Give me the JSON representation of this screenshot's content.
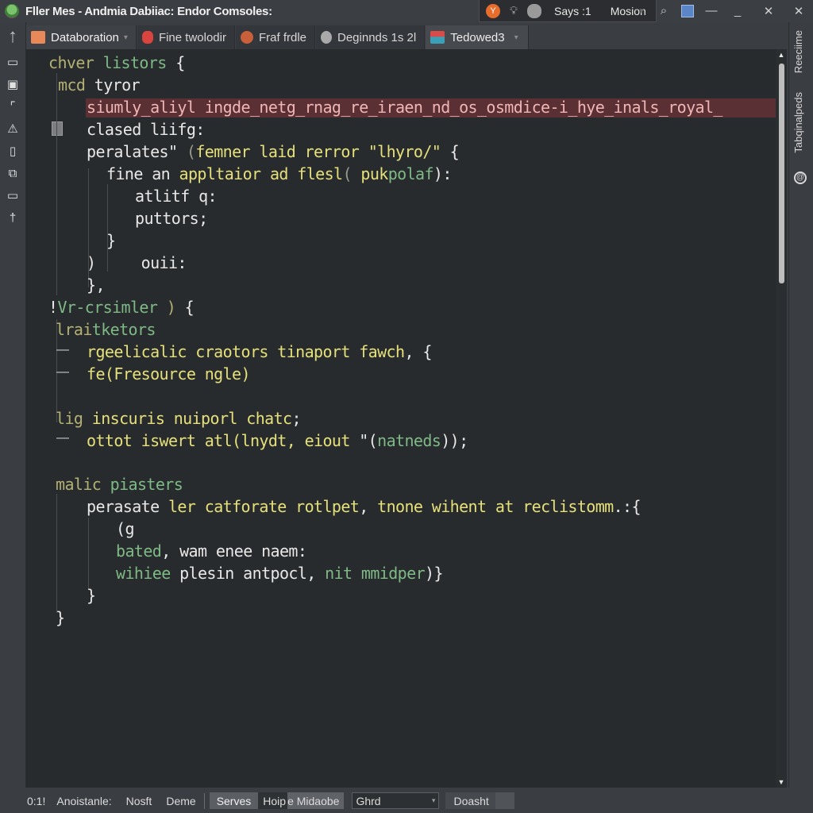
{
  "window": {
    "title": "Fller Mes - Andmia  Dabiiac: Endor Comsoles:",
    "toolbar": {
      "label_1": "Says :1",
      "label_2": "Mosion"
    },
    "controls": {
      "dropdown": "▾",
      "search": "⌕",
      "minimize_1": "—",
      "minimize_2": "_",
      "close_1": "✕",
      "close_2": "✕"
    }
  },
  "activity_bar": {
    "items": [
      {
        "name": "navigate-up-icon",
        "glyph": "↑"
      },
      {
        "name": "panel-icon",
        "glyph": "▭"
      },
      {
        "name": "device-icon",
        "glyph": "▣"
      },
      {
        "name": "corner-icon",
        "glyph": "⌜"
      },
      {
        "name": "debug-icon",
        "glyph": "⚠"
      },
      {
        "name": "phone-icon",
        "glyph": "▯"
      },
      {
        "name": "copy-icon",
        "glyph": "⧉"
      },
      {
        "name": "window-icon",
        "glyph": "▭"
      },
      {
        "name": "pin-icon",
        "glyph": "†"
      }
    ]
  },
  "tabs": [
    {
      "label": "Databoration",
      "icon": "folder-icon",
      "icon_color": "#e9895a",
      "has_caret": true,
      "caret": "▾"
    },
    {
      "label": "Fine twolodir",
      "icon": "bug-icon",
      "icon_color": "#d9443f"
    },
    {
      "label": "Fraf frdle",
      "icon": "avatar-icon",
      "icon_color": "#c9603a"
    },
    {
      "label": "Deginnds 1s 2l",
      "icon": "cloud-icon",
      "icon_color": "#a9a9a9"
    },
    {
      "label": "Tedowed3",
      "icon": "layout-icon",
      "icon_color": "#d84b4b",
      "active": true,
      "caret": "▾"
    }
  ],
  "right_panel": {
    "label_1": "Reeciime",
    "label_2": "Tabqinalpeds",
    "icon": "@"
  },
  "editor": {
    "lines": [
      {
        "parts": [
          [
            "chver ",
            "olive"
          ],
          [
            "listors",
            "green"
          ],
          [
            " {",
            "white"
          ]
        ]
      },
      {
        "parts": [
          [
            "mcd",
            "olive"
          ],
          [
            " tyror",
            "white"
          ]
        ]
      },
      {
        "parts": [
          [
            "siumly_aliyl ingde_netg_rnag_re_iraen_nd_os_osmdice-i_hye_inals_royal_",
            "err"
          ]
        ]
      },
      {
        "parts": [
          [
            "clased liifg:",
            "white"
          ]
        ]
      },
      {
        "parts": [
          [
            "peralates\" ",
            "white"
          ],
          [
            "(",
            "gray"
          ],
          [
            "femner laid rerror \"lhyro/\"",
            "yellow"
          ],
          [
            " {",
            "white"
          ]
        ]
      },
      {
        "parts": [
          [
            "fine an ",
            "white"
          ],
          [
            "appltaior ad flesl",
            "yellow"
          ],
          [
            "( ",
            "gray"
          ],
          [
            "puk",
            "yellow"
          ],
          [
            "polaf",
            "green"
          ],
          [
            "):",
            "white"
          ]
        ]
      },
      {
        "parts": [
          [
            "atlitf q:",
            "white"
          ]
        ]
      },
      {
        "parts": [
          [
            "puttors;",
            "white"
          ]
        ]
      },
      {
        "parts": [
          [
            "}",
            "white"
          ]
        ]
      },
      {
        "parts": [
          [
            ")     ouii:",
            "white"
          ]
        ]
      },
      {
        "parts": [
          [
            "},",
            "white"
          ]
        ]
      },
      {
        "parts": [
          [
            "!",
            "white"
          ],
          [
            "Vr-crsimler",
            "green"
          ],
          [
            " ) ",
            "olive"
          ],
          [
            "{",
            "white"
          ]
        ]
      },
      {
        "parts": [
          [
            "lrai",
            "olive"
          ],
          [
            "tketors",
            "green"
          ]
        ]
      },
      {
        "parts": [
          [
            "rgeelicalic craotors tinaport fawch",
            "yellow"
          ],
          [
            ", {",
            "white"
          ]
        ]
      },
      {
        "parts": [
          [
            "fe(Fresource ngle)",
            "yellow"
          ]
        ]
      },
      {
        "parts": [
          [
            "",
            "white"
          ]
        ]
      },
      {
        "parts": [
          [
            "lig",
            "olive"
          ],
          [
            " inscuris nuiporl chatc",
            "yellow"
          ],
          [
            ";",
            "white"
          ]
        ]
      },
      {
        "parts": [
          [
            "ottot iswert atl(lnydt, eiout ",
            "yellow"
          ],
          [
            "\"(",
            "white"
          ],
          [
            "natneds",
            "green"
          ],
          [
            "));",
            "white"
          ]
        ]
      },
      {
        "parts": [
          [
            "",
            "white"
          ]
        ]
      },
      {
        "parts": [
          [
            "malic",
            "olive"
          ],
          [
            " piasters",
            "green"
          ]
        ]
      },
      {
        "parts": [
          [
            "perasate ",
            "white"
          ],
          [
            "ler catforate rotlpet",
            "yellow"
          ],
          [
            ", ",
            "white"
          ],
          [
            "tnone wihent at reclistomm",
            "yellow"
          ],
          [
            ".:{",
            "white"
          ]
        ]
      },
      {
        "parts": [
          [
            "(g",
            "white"
          ]
        ]
      },
      {
        "parts": [
          [
            "bated",
            "green"
          ],
          [
            ", wam enee naem:",
            "white"
          ]
        ]
      },
      {
        "parts": [
          [
            "wihiee",
            "green"
          ],
          [
            " plesin antpocl, ",
            "white"
          ],
          [
            "nit mmidper",
            "green"
          ],
          [
            ")}",
            "white"
          ]
        ]
      },
      {
        "parts": [
          [
            "}",
            "white"
          ]
        ]
      },
      {
        "parts": [
          [
            "}",
            "white"
          ]
        ]
      }
    ]
  },
  "scrollbar": {
    "up": "▲",
    "down": "▼",
    "position_fraction": 0.0,
    "visible_fraction": 0.31
  },
  "statusbar": {
    "position": "0:1!",
    "item_1": "Anoistanle:",
    "item_2": "Nosft",
    "item_3": "Deme",
    "button_serves": "Serves",
    "button_hoipe_dark": "Hoip",
    "button_hoipe_light": "e Midaobe",
    "select_value": "Ghrd",
    "select_arrow": "▾",
    "button_doasht": "Doasht"
  }
}
